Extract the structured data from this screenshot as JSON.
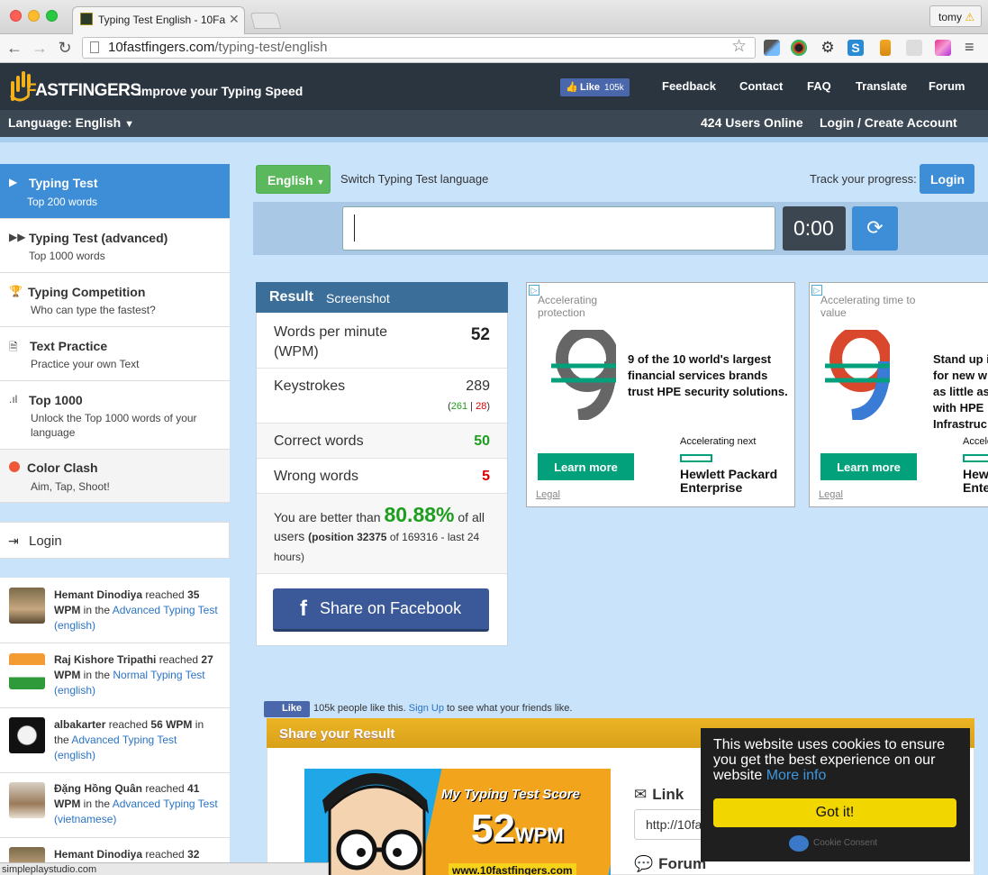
{
  "browser": {
    "tab_title": "Typing Test English - 10Fa",
    "url_domain": "10fastfingers.com",
    "url_path": "/typing-test/english",
    "profile_name": "tomy",
    "status_url": "simpleplaystudio.com"
  },
  "header": {
    "logo_prefix": "F",
    "logo_text": "ASTFINGERS",
    "tagline": "Improve your Typing Speed",
    "fb_like_label": "Like",
    "fb_like_count": "105k",
    "nav": [
      "Feedback",
      "Contact",
      "FAQ",
      "Translate",
      "Forum"
    ],
    "language_label": "Language: English",
    "users_online": "424 Users Online",
    "login_create": "Login / Create Account"
  },
  "sidebar": {
    "items": [
      {
        "title": "Typing Test",
        "sub": "Top 200 words"
      },
      {
        "title": "Typing Test (advanced)",
        "sub": "Top 1000 words"
      },
      {
        "title": "Typing Competition",
        "sub": "Who can type the fastest?"
      },
      {
        "title": "Text Practice",
        "sub": "Practice your own Text"
      },
      {
        "title": "Top 1000",
        "sub": "Unlock the Top 1000 words of your language"
      },
      {
        "title": "Color Clash",
        "sub": "Aim, Tap, Shoot!"
      }
    ],
    "login_label": "Login",
    "feed": [
      {
        "name": "Hemant Dinodiya",
        "pre": " reached ",
        "wpm": "35 WPM",
        "mid": " in the ",
        "link": "Advanced Typing Test (english)"
      },
      {
        "name": "Raj Kishore Tripathi",
        "pre": " reached ",
        "wpm": "27 WPM",
        "mid": " in the ",
        "link": "Normal Typing Test (english)"
      },
      {
        "name": "albakarter",
        "pre": " reached ",
        "wpm": "56 WPM",
        "mid": " in the ",
        "link": "Advanced Typing Test (english)"
      },
      {
        "name": "Đặng Hồng Quân",
        "pre": " reached ",
        "wpm": "41 WPM",
        "mid": " in the ",
        "link": "Advanced Typing Test (vietnamese)"
      },
      {
        "name": "Hemant Dinodiya",
        "pre": " reached ",
        "wpm": "32",
        "mid": "",
        "link": ""
      }
    ]
  },
  "main": {
    "lang_button": "English",
    "switch_label": "Switch Typing Test language",
    "track_label": "Track your progress:",
    "login_button": "Login",
    "timer": "0:00"
  },
  "result": {
    "title": "Result",
    "screenshot_tab": "Screenshot",
    "wpm_label": "Words per minute (WPM)",
    "wpm_value": "52",
    "keystrokes_label": "Keystrokes",
    "keystrokes_value": "289",
    "keystrokes_correct": "261",
    "keystrokes_sep": " | ",
    "keystrokes_wrong": "28",
    "correct_label": "Correct words",
    "correct_value": "50",
    "wrong_label": "Wrong words",
    "wrong_value": "5",
    "better_pre": "You are better than ",
    "better_pct": "80.88%",
    "better_post": " of all users ",
    "position": "(position 32375",
    "position_rest": " of 169316 - last 24 hours)",
    "share_fb": "Share on Facebook"
  },
  "ads": [
    {
      "tag": "Accelerating protection",
      "headline": "9 of the 10 world's largest financial services brands trust HPE security solutions.",
      "cta": "Learn more",
      "next": "Accelerating next",
      "brand": "Hewlett Packard Enterprise",
      "legal": "Legal"
    },
    {
      "tag": "Accelerating time to value",
      "headline": "Stand up i for new w as little as with HPE Infrastruc",
      "cta": "Learn more",
      "next": "Accele",
      "brand": "Hewl Ente",
      "legal": "Legal"
    }
  ],
  "share": {
    "fb_like": "Like",
    "fb_text": "105k people like this.",
    "fb_signup": "Sign Up",
    "fb_rest": "to see what your friends like.",
    "title": "Share your Result",
    "img_title": "My Typing Test Score",
    "img_wpm": "52",
    "img_wpm_unit": "WPM",
    "img_url": "www.10fastfingers.com",
    "link_label": "Link",
    "link_value": "http://10fa",
    "forum_label": "Forum"
  },
  "cookie": {
    "text": "This website uses cookies to ensure you get the best experience on our website",
    "more_info": "More info",
    "button": "Got it!",
    "brand": "Cookie Consent"
  },
  "colors": {
    "accent_blue": "#3d8ed7",
    "header_dark": "#2b3540",
    "green_button": "#5cb85c",
    "facebook": "#3b5998",
    "hpe_green": "#02a07b",
    "cookie_yellow": "#f1d600"
  }
}
